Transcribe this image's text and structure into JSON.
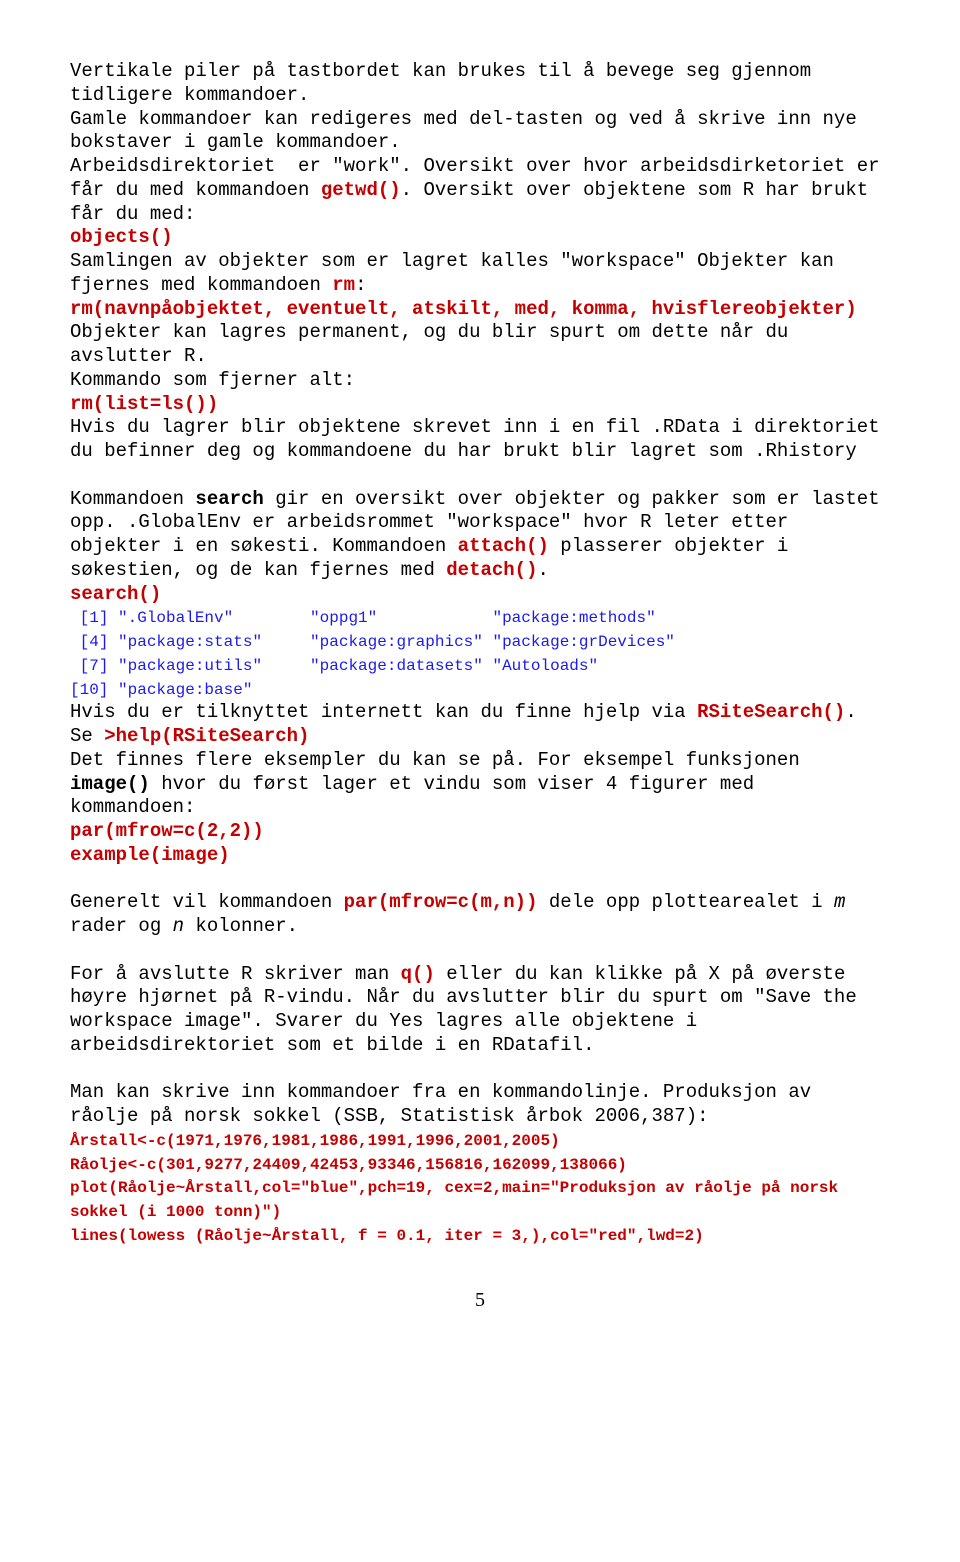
{
  "p1": {
    "t1": "Vertikale piler på tastbordet kan brukes til å bevege seg gjennom tidligere kommandoer.",
    "t2": "Gamle kommandoer kan redigeres med del-tasten og ved å skrive inn nye bokstaver i gamle kommandoer.",
    "t3": "Arbeidsdirektoriet  er \"work\". Oversikt over hvor arbeidsdirketoriet er får du med kommandoen ",
    "c1": "getwd()",
    "t4": ". Oversikt over objektene som R har brukt får du med:",
    "c2": "objects()",
    "t5": "Samlingen av objekter som er lagret kalles \"workspace\" Objekter kan fjernes med kommandoen ",
    "c3": "rm",
    "t6": ":",
    "c4": "rm(navnpåobjektet, eventuelt, atskilt, med, komma, hvisflereobjekter)",
    "t7": "Objekter kan lagres permanent, og du blir spurt om dette når du avslutter R.",
    "t8": "Kommando som fjerner alt:",
    "c5": "rm(list=ls())",
    "t9": "Hvis du lagrer blir objektene skrevet inn i en fil .RData i direktoriet du befinner deg og kommandoene du har brukt blir lagret som .Rhistory"
  },
  "p2": {
    "t1": "Kommandoen ",
    "b1": "search",
    "t2": " gir en oversikt over objekter og pakker som er lastet opp. .GlobalEnv er arbeidsrommet \"workspace\" hvor R leter etter objekter i en søkesti. Kommandoen ",
    "c1": "attach()",
    "t3": " plasserer objekter i søkestien, og de kan fjernes med ",
    "c2": "detach()",
    "t4": ".",
    "c3": "search()",
    "out1": " [1] \".GlobalEnv\"        \"oppg1\"            \"package:methods\"",
    "out2": " [4] \"package:stats\"     \"package:graphics\" \"package:grDevices\"",
    "out3": " [7] \"package:utils\"     \"package:datasets\" \"Autoloads\"",
    "out4": "[10] \"package:base\"",
    "t5": "Hvis du er tilknyttet internett kan du finne hjelp via ",
    "c4": "RSiteSearch()",
    "t6": ". Se ",
    "c5": ">help(RSiteSearch)",
    "t7": "Det finnes flere eksempler du kan se på. For eksempel funksjonen ",
    "b2": "image()",
    "t8": " hvor du først lager et vindu som viser 4 figurer med kommandoen:",
    "c6": "par(mfrow=c(2,2))",
    "c7": "example(image)"
  },
  "p3": {
    "t1": "Generelt vil kommandoen ",
    "c1": "par(mfrow=c(m,n))",
    "t2": " dele opp plottearealet i ",
    "i1": "m",
    "t3": " rader og ",
    "i2": "n",
    "t4": " kolonner."
  },
  "p4": {
    "t1": "For å avslutte R skriver man ",
    "c1": "q()",
    "t2": " eller du kan klikke på X på øverste høyre hjørnet på R-vindu. Når du avslutter blir du spurt om \"Save the workspace image\". Svarer du Yes lagres alle objektene i arbeidsdirektoriet som et bilde i en RDatafil."
  },
  "p5": {
    "t1": "Man kan skrive inn kommandoer fra en kommandolinje. Produksjon av råolje på norsk sokkel (SSB, Statistisk årbok 2006,387):",
    "c1": "Årstall<-c(1971,1976,1981,1986,1991,1996,2001,2005)",
    "c2": "Råolje<-c(301,9277,24409,42453,93346,156816,162099,138066)",
    "c3": "plot(Råolje~Årstall,col=\"blue\",pch=19, cex=2,main=\"Produksjon av råolje på norsk sokkel (i 1000 tonn)\")",
    "c4": "lines(lowess (Råolje~Årstall, f = 0.1, iter = 3,),col=\"red\",lwd=2)"
  },
  "pagenum": "5"
}
